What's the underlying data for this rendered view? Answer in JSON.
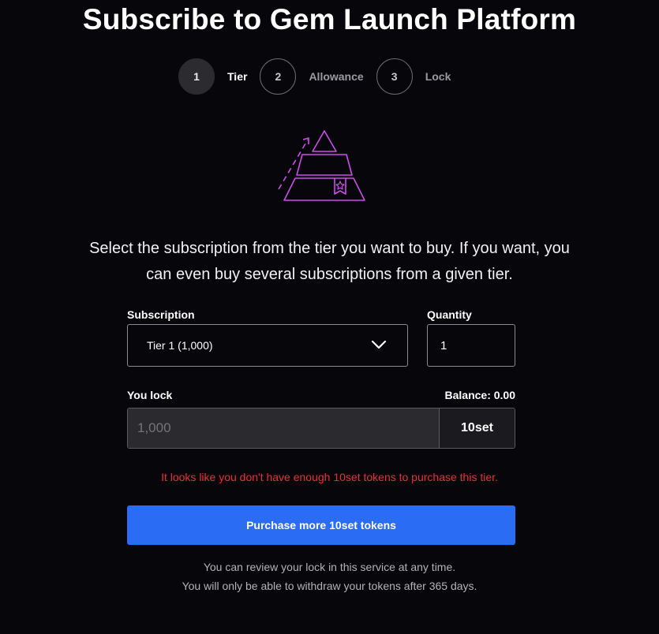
{
  "title": "Subscribe to Gem Launch Platform",
  "steps": [
    {
      "number": "1",
      "label": "Tier",
      "active": true
    },
    {
      "number": "2",
      "label": "Allowance",
      "active": false
    },
    {
      "number": "3",
      "label": "Lock",
      "active": false
    }
  ],
  "illustration": {
    "icon": "pyramid-tier-icon",
    "color": "#c94fe8"
  },
  "description": {
    "line1": "Select the subscription from the tier you want to buy. If you want, you",
    "line2": "can even buy several subscriptions from a given tier."
  },
  "subscription": {
    "label": "Subscription",
    "selected": "Tier 1 (1,000)",
    "icon": "chevron-down-icon"
  },
  "quantity": {
    "label": "Quantity",
    "value": "1"
  },
  "lock": {
    "label": "You lock",
    "balance": "Balance: 0.00",
    "placeholder": "1,000",
    "token": "10set"
  },
  "error": "It looks like you don't have enough 10set tokens to purchase this tier.",
  "cta": "Purchase more 10set tokens",
  "notes": {
    "line1": "You can review your lock in this service at any time.",
    "line2": "You will only be able to withdraw your tokens after 365 days."
  },
  "colors": {
    "accent": "#2a6df4",
    "error": "#e8313a",
    "illustration": "#c94fe8",
    "background": "#07070b"
  }
}
